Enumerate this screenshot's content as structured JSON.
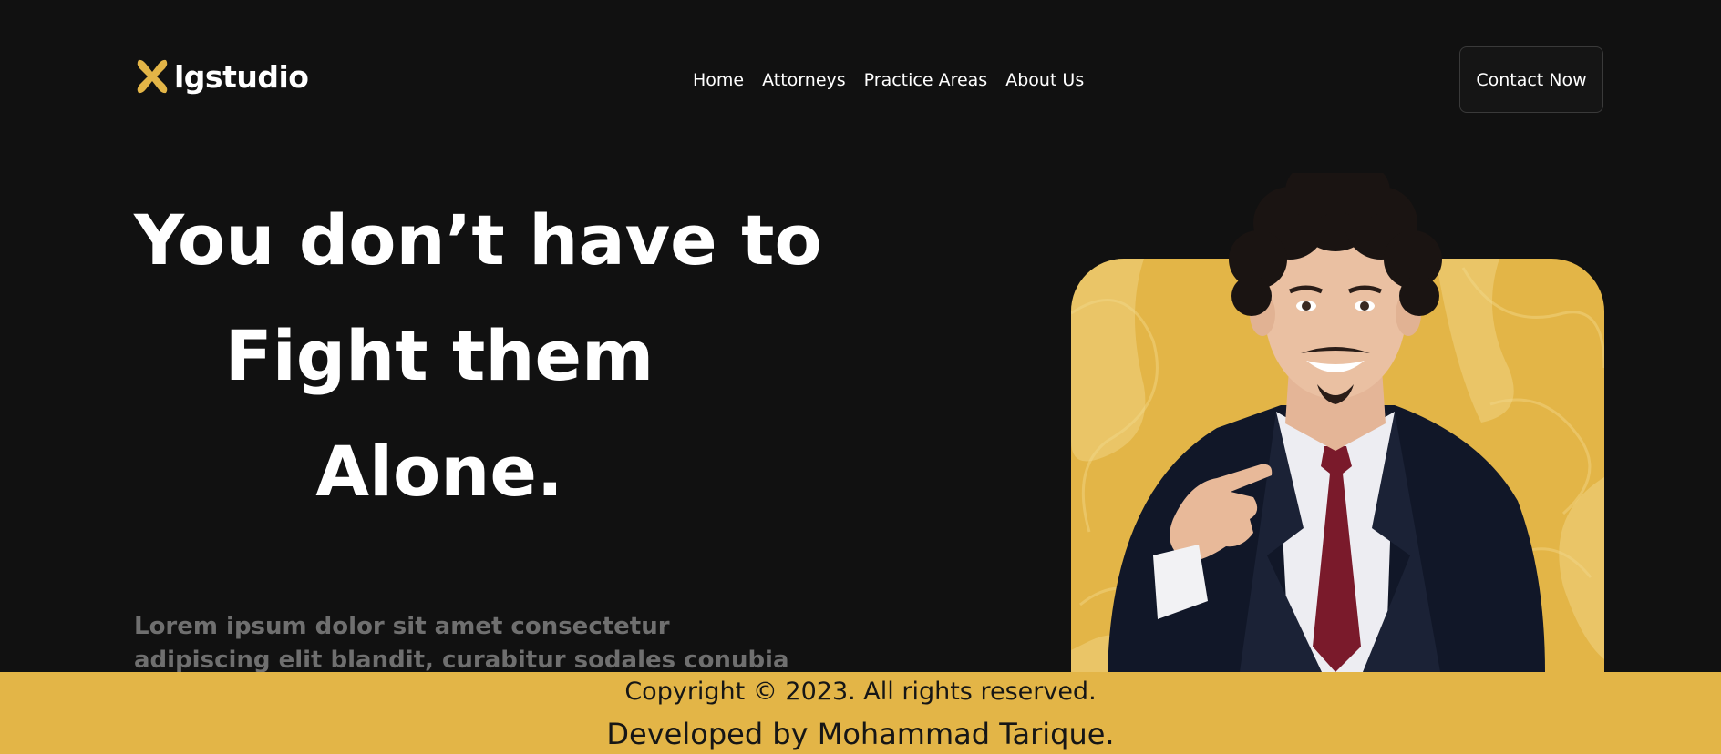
{
  "brand": {
    "name": "lgstudio",
    "accent_color": "#e3b547",
    "logo_icon": "x-mark-icon"
  },
  "nav": {
    "items": [
      {
        "label": "Home"
      },
      {
        "label": "Attorneys"
      },
      {
        "label": "Practice Areas"
      },
      {
        "label": "About Us"
      }
    ],
    "cta_label": "Contact Now"
  },
  "hero": {
    "title_lines": [
      "You don’t have to",
      "Fight them",
      "Alone."
    ],
    "description_lines": [
      "Lorem ipsum dolor sit amet consectetur",
      "adipiscing elit blandit, curabitur sodales conubia"
    ],
    "image_icon": "attorney-portrait-pointing"
  },
  "footer": {
    "copyright": "Copyright © 2023. All rights reserved.",
    "developer": "Developed by Mohammad Tarique."
  }
}
